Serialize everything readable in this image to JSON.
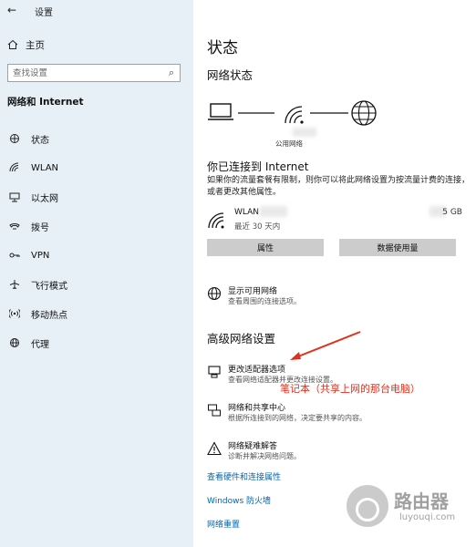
{
  "window": {
    "back_glyph": "←",
    "title": "设置"
  },
  "sidebar": {
    "home_label": "主页",
    "search_placeholder": "查找设置",
    "section_title": "网络和 Internet",
    "items": [
      {
        "label": "状态",
        "icon": "status-icon"
      },
      {
        "label": "WLAN",
        "icon": "wifi-icon"
      },
      {
        "label": "以太网",
        "icon": "ethernet-icon"
      },
      {
        "label": "拨号",
        "icon": "dialup-icon"
      },
      {
        "label": "VPN",
        "icon": "vpn-icon"
      },
      {
        "label": "飞行模式",
        "icon": "airplane-icon"
      },
      {
        "label": "移动热点",
        "icon": "hotspot-icon"
      },
      {
        "label": "代理",
        "icon": "proxy-icon"
      }
    ]
  },
  "main": {
    "title": "状态",
    "network_status_heading": "网络状态",
    "public_network_label": "公用网络",
    "connected_title": "你已连接到 Internet",
    "connected_desc": "如果你的流量套餐有限制，则你可以将此网络设置为按流量计费的连接，或者更改其他属性。",
    "wlan": {
      "name": "WLAN",
      "period": "最近 30 天内",
      "usage": "5 GB"
    },
    "buttons": {
      "properties": "属性",
      "data_usage": "数据使用量"
    },
    "show_networks": {
      "title": "显示可用网络",
      "desc": "查看周围的连接选项。"
    },
    "advanced_heading": "高级网络设置",
    "adapter_options": {
      "title": "更改适配器选项",
      "desc": "查看网络适配器并更改连接设置。"
    },
    "sharing_center": {
      "title": "网络和共享中心",
      "desc": "根据所连接到的网络，决定要共享的内容。"
    },
    "troubleshooter": {
      "title": "网络疑难解答",
      "desc": "诊断并解决网络问题。"
    },
    "links": {
      "hardware": "查看硬件和连接属性",
      "firewall": "Windows 防火墙",
      "reset": "网络重置"
    }
  },
  "annotation": {
    "text": "笔记本（共享上网的那台电脑）",
    "color": "#e0301e"
  },
  "watermark": {
    "text": "路由器",
    "url": "luyouqi.com"
  },
  "colors": {
    "sidebar_bg": "#e6f0f6",
    "button_bg": "#cccccc",
    "link": "#0066b4"
  }
}
